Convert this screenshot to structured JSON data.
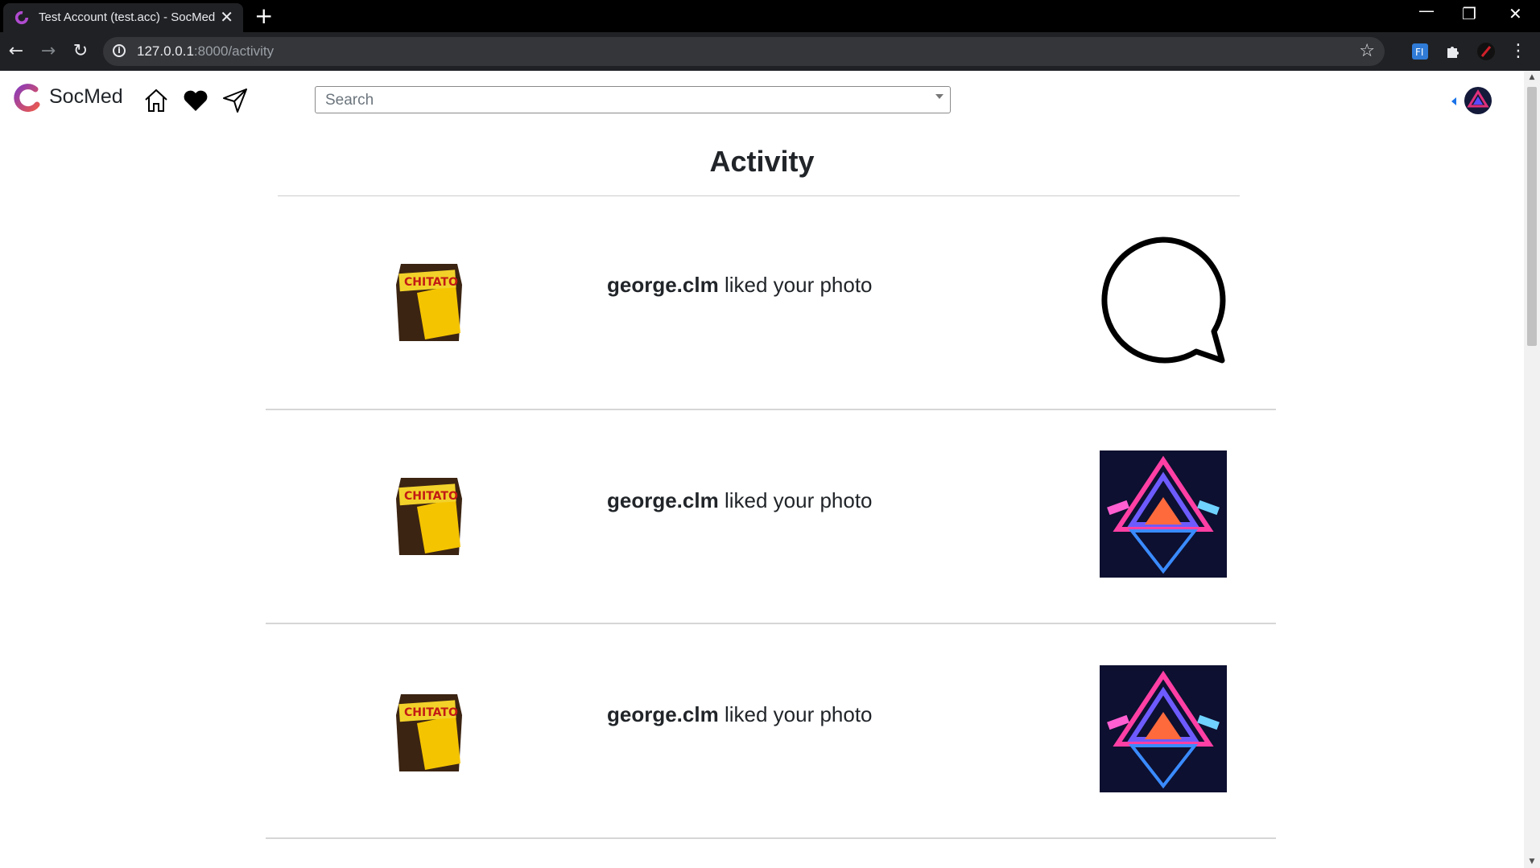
{
  "browser": {
    "tab_title": "Test Account (test.acc) - SocMed",
    "tab_close": "✕",
    "new_tab": "+",
    "url_host": "127.0.0.1",
    "url_rest": ":8000/activity",
    "info": "i",
    "star": "☆",
    "window_controls": {
      "minimize": "—",
      "restore": "❐",
      "close": "✕"
    },
    "nav": {
      "back": "←",
      "forward": "→",
      "reload": "↻"
    }
  },
  "navbar": {
    "brand": "SocMed",
    "search_placeholder": "Search",
    "icons": [
      "home-icon",
      "heart-icon",
      "send-icon"
    ]
  },
  "page": {
    "title": "Activity"
  },
  "activities": [
    {
      "user": "george.clm",
      "action": "liked your photo",
      "media": "comment-bubble-icon"
    },
    {
      "user": "george.clm",
      "action": "liked your photo",
      "media": "neon-triangle-image"
    },
    {
      "user": "george.clm",
      "action": "liked your photo",
      "media": "neon-triangle-image"
    }
  ],
  "colors": {
    "chrome_dark": "#202124",
    "tabbar": "#000000",
    "accent_blue": "#1a73e8",
    "text": "#212529"
  }
}
